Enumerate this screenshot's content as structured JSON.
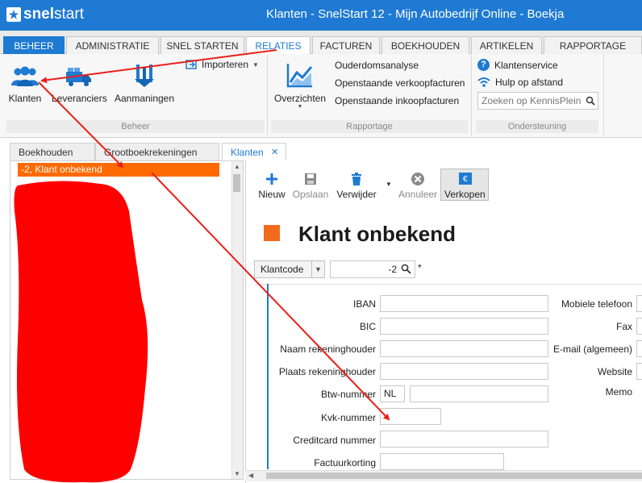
{
  "app": {
    "logo_bold": "snel",
    "logo_light": "start",
    "window_title": "Klanten - SnelStart 12 - Mijn Autobedrijf Online - Boekja"
  },
  "ribbon_tabs": [
    "BEHEER",
    "ADMINISTRATIE",
    "SNEL STARTEN",
    "RELATIES",
    "FACTUREN",
    "BOEKHOUDEN",
    "ARTIKELEN",
    "RAPPORTAGE"
  ],
  "ribbon": {
    "beheer": {
      "klanten": "Klanten",
      "leveranciers": "Leveranciers",
      "aanmaningen": "Aanmaningen",
      "importeren": "Importeren",
      "group_label": "Beheer"
    },
    "rapportage": {
      "overzichten": "Overzichten",
      "ouderdomsanalyse": "Ouderdomsanalyse",
      "openstaande_verkoop": "Openstaande verkoopfacturen",
      "openstaande_inkoop": "Openstaande inkoopfacturen",
      "group_label": "Rapportage"
    },
    "ondersteuning": {
      "klantenservice": "Klantenservice",
      "hulp": "Hulp op afstand",
      "search_placeholder": "Zoeken op KennisPlein",
      "group_label": "Ondersteuning"
    }
  },
  "doc_tabs": [
    "Boekhouden",
    "Grootboekrekeningen",
    "Klanten"
  ],
  "doc_tab_close": "✕",
  "list": {
    "selected": "-2, Klant onbekend"
  },
  "toolbar": {
    "nieuw": "Nieuw",
    "opslaan": "Opslaan",
    "verwijder": "Verwijder",
    "annuleer": "Annuleer",
    "verkopen": "Verkopen"
  },
  "page_title": "Klant onbekend",
  "klantcode": {
    "label": "Klantcode",
    "value": "-2",
    "required_mark": "*"
  },
  "form": {
    "iban": "IBAN",
    "bic": "BIC",
    "naam_rekeninghouder": "Naam rekeninghouder",
    "plaats_rekeninghouder": "Plaats rekeninghouder",
    "btw_nummer": "Btw-nummer",
    "btw_prefix": "NL",
    "kvk_nummer": "Kvk-nummer",
    "creditcard": "Creditcard nummer",
    "factuurkorting": "Factuurkorting",
    "mobiele_telefoon": "Mobiele telefoon",
    "fax": "Fax",
    "email": "E-mail (algemeen)",
    "website": "Website",
    "memo": "Memo"
  },
  "colors": {
    "brand_blue": "#1e7ad2",
    "selection_orange": "#ff6a00",
    "annotation_red": "#e8201a"
  }
}
